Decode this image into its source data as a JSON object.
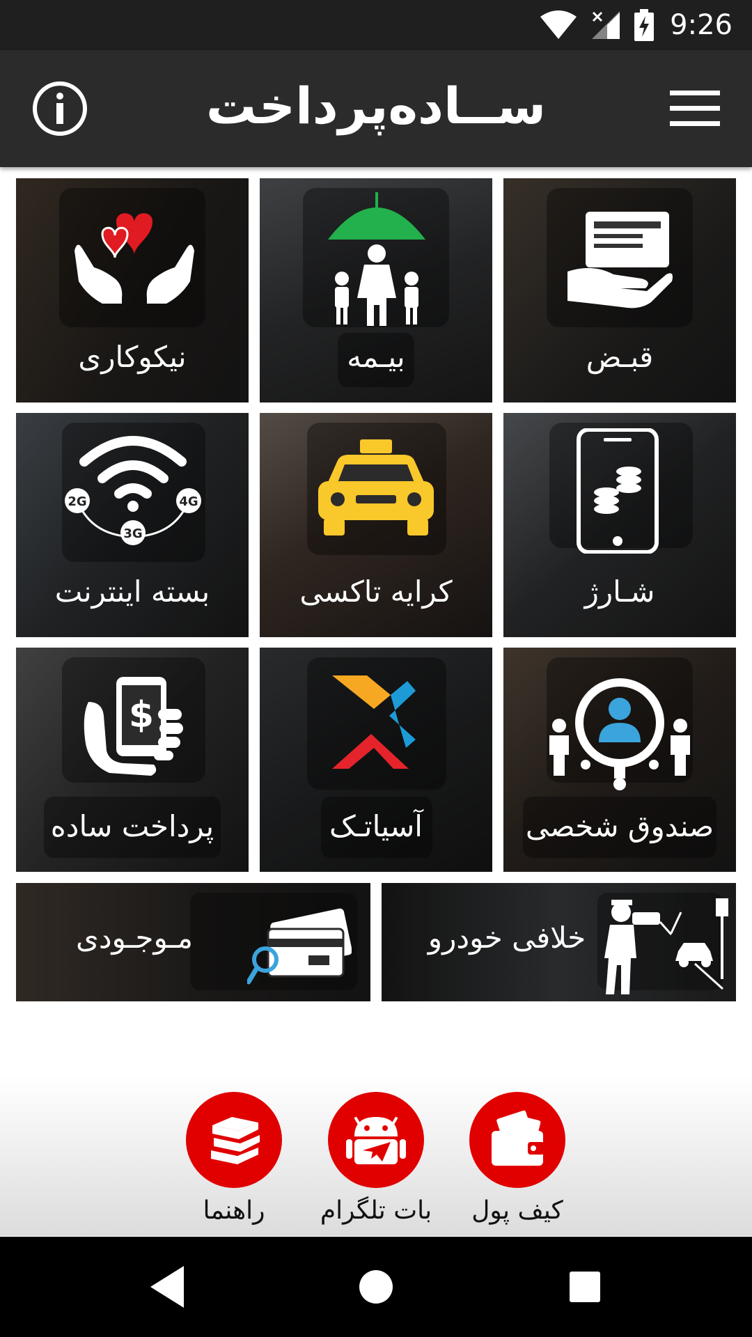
{
  "status_bar": {
    "time": "9:26",
    "icons": [
      "wifi-icon",
      "no-signal-icon",
      "battery-charging-icon"
    ]
  },
  "app_bar": {
    "title": "ســاده‌پرداخت",
    "left_icon": "info-icon",
    "right_icon": "hamburger-menu-icon"
  },
  "tiles": [
    {
      "label": "قبـض",
      "icon": "bill-hand-icon"
    },
    {
      "label": "بیـمه",
      "icon": "umbrella-family-icon"
    },
    {
      "label": "نیکوکاری",
      "icon": "hands-heart-icon"
    },
    {
      "label": "شـارژ",
      "icon": "phone-coins-icon"
    },
    {
      "label": "کرایه تاکسی",
      "icon": "taxi-icon"
    },
    {
      "label": "بسته اینترنت",
      "icon": "wifi-2g-3g-4g-icon"
    },
    {
      "label": "صندوق شخصی",
      "icon": "people-target-icon"
    },
    {
      "label": "آسیاتـک",
      "icon": "asiatech-logo-icon"
    },
    {
      "label": "پرداخت ساده",
      "icon": "hand-phone-dollar-icon"
    },
    {
      "label": "خلافی خودرو",
      "icon": "traffic-police-icon"
    },
    {
      "label": "مـوجـودی",
      "icon": "card-magnifier-icon"
    }
  ],
  "bottom_actions": [
    {
      "label": "کیف پول",
      "icon": "wallet-icon"
    },
    {
      "label": "بات تلگرام",
      "icon": "android-telegram-icon"
    },
    {
      "label": "راهنما",
      "icon": "books-icon"
    }
  ],
  "nav_bar": {
    "icons": [
      "back-icon",
      "home-icon",
      "recents-icon"
    ]
  },
  "colors": {
    "app_bar": "#2b2b2b",
    "status_bar": "#1f1f1f",
    "accent_red": "#e00000",
    "taxi_yellow": "#f9c82a",
    "umbrella_green": "#22b14c",
    "heart_red": "#e11b22",
    "asiatech_orange": "#f7a823",
    "asiatech_blue": "#1d9bd7",
    "asiatech_red": "#e4242a",
    "person_blue": "#3ba4dc"
  }
}
